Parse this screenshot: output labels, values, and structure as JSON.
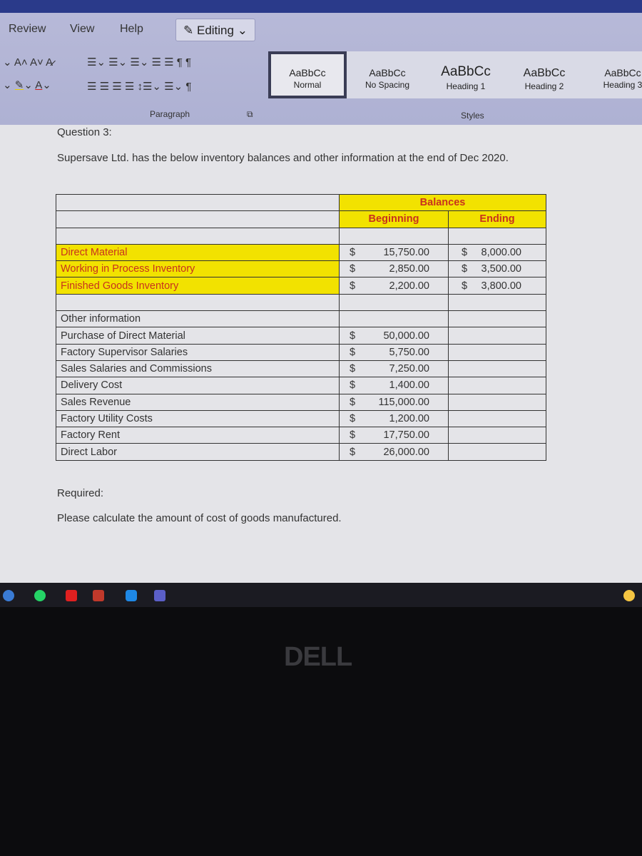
{
  "ribbon": {
    "tabs": [
      "Review",
      "View",
      "Help"
    ],
    "editing": "Editing",
    "paragraph_group": "Paragraph",
    "styles_group": "Styles",
    "styles": [
      {
        "sample": "AaBbCc",
        "name": "Normal"
      },
      {
        "sample": "AaBbCc",
        "name": "No Spacing"
      },
      {
        "sample": "AaBbCc",
        "name": "Heading 1"
      },
      {
        "sample": "AaBbCc",
        "name": "Heading 2"
      },
      {
        "sample": "AaBbCc",
        "name": "Heading 3"
      }
    ]
  },
  "doc": {
    "question": "Question 3:",
    "intro": "Supersave Ltd. has the below inventory balances and other information at the end of Dec 2020.",
    "required": "Required:",
    "task": "Please calculate the amount of cost of goods manufactured.",
    "table": {
      "group_header": "Balances",
      "col_beginning": "Beginning",
      "col_ending": "Ending",
      "currency": "$",
      "inventory": [
        {
          "label": "Direct Material",
          "beginning": "15,750.00",
          "ending": "8,000.00"
        },
        {
          "label": "Working in Process Inventory",
          "beginning": "2,850.00",
          "ending": "3,500.00"
        },
        {
          "label": "Finished Goods Inventory",
          "beginning": "2,200.00",
          "ending": "3,800.00"
        }
      ],
      "other_header": "Other information",
      "other": [
        {
          "label": "Purchase of Direct Material",
          "value": "50,000.00"
        },
        {
          "label": "Factory Supervisor Salaries",
          "value": "5,750.00"
        },
        {
          "label": "Sales Salaries and Commissions",
          "value": "7,250.00"
        },
        {
          "label": "Delivery Cost",
          "value": "1,400.00"
        },
        {
          "label": "Sales Revenue",
          "value": "115,000.00"
        },
        {
          "label": "Factory Utility Costs",
          "value": "1,200.00"
        },
        {
          "label": "Factory Rent",
          "value": "17,750.00"
        },
        {
          "label": "Direct Labor",
          "value": "26,000.00"
        }
      ]
    }
  },
  "laptop": {
    "brand": "DELL"
  },
  "colors": {
    "highlight": "#f2e200",
    "highlight_text": "#c8321e",
    "ribbon": "#b7b9d8"
  }
}
